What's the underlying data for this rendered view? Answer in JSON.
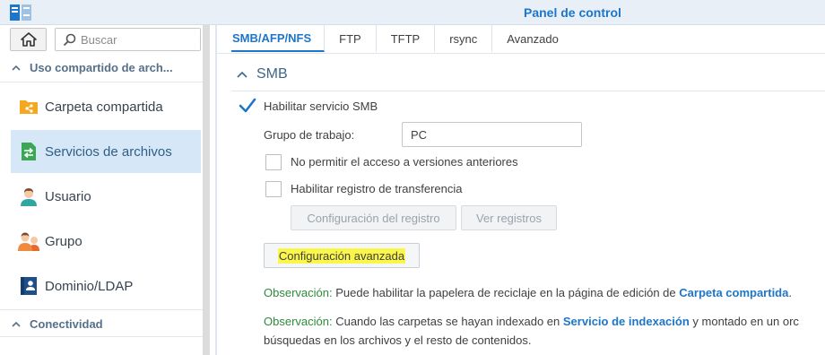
{
  "window": {
    "title": "Panel de control"
  },
  "sidebar": {
    "search_placeholder": "Buscar",
    "section_sharing": "Uso compartido de arch...",
    "items": [
      {
        "label": "Carpeta compartida",
        "icon": "shared-folder-icon"
      },
      {
        "label": "Servicios de archivos",
        "icon": "file-services-icon",
        "active": true
      },
      {
        "label": "Usuario",
        "icon": "user-icon"
      },
      {
        "label": "Grupo",
        "icon": "group-icon"
      },
      {
        "label": "Dominio/LDAP",
        "icon": "domain-ldap-icon"
      }
    ],
    "section_connectivity": "Conectividad"
  },
  "tabs": [
    {
      "label": "SMB/AFP/NFS",
      "active": true
    },
    {
      "label": "FTP"
    },
    {
      "label": "TFTP"
    },
    {
      "label": "rsync"
    },
    {
      "label": "Avanzado"
    }
  ],
  "smb": {
    "section_title": "SMB",
    "enable_label": "Habilitar servicio SMB",
    "enable_checked": true,
    "workgroup_label": "Grupo de trabajo:",
    "workgroup_value": "PC",
    "deny_prev_versions_label": "No permitir el acceso a versiones anteriores",
    "deny_prev_versions_checked": false,
    "transfer_log_label": "Habilitar registro de transferencia",
    "transfer_log_checked": false,
    "log_settings_button": "Configuración del registro",
    "view_logs_button": "Ver registros",
    "advanced_settings_button": "Configuración avanzada",
    "note1": {
      "prefix": "Observación:",
      "text": " Puede habilitar la papelera de reciclaje en la página de edición de ",
      "link": "Carpeta compartida",
      "suffix": "."
    },
    "note2": {
      "prefix": "Observación:",
      "text": " Cuando las carpetas se hayan indexado en ",
      "link": "Servicio de indexación",
      "text2": " y montado en un orc",
      "line2": "búsquedas en los archivos y el resto de contenidos."
    }
  },
  "colors": {
    "accent": "#1d76c9",
    "note_green": "#2e8b3b",
    "highlight": "#fbf64a",
    "active_item_bg": "#d6e8f7"
  }
}
